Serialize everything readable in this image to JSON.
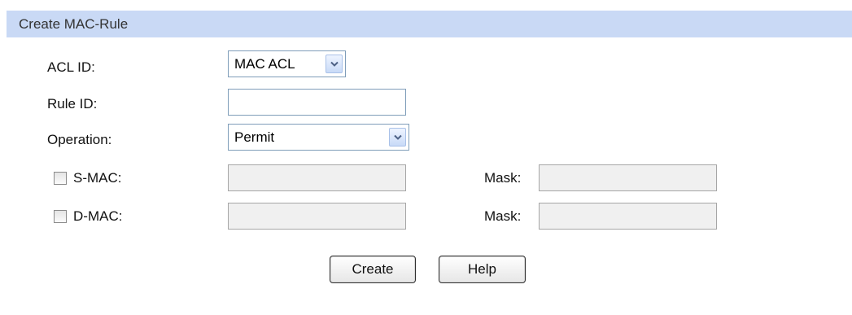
{
  "panel": {
    "title": "Create MAC-Rule"
  },
  "form": {
    "acl_id": {
      "label": "ACL ID:",
      "selected": "MAC ACL"
    },
    "rule_id": {
      "label": "Rule ID:",
      "value": ""
    },
    "operation": {
      "label": "Operation:",
      "selected": "Permit"
    },
    "s_mac": {
      "label": "S-MAC:",
      "checked": false,
      "value": "",
      "mask_label": "Mask:",
      "mask_value": ""
    },
    "d_mac": {
      "label": "D-MAC:",
      "checked": false,
      "value": "",
      "mask_label": "Mask:",
      "mask_value": ""
    }
  },
  "buttons": {
    "create": "Create",
    "help": "Help"
  },
  "icons": {
    "dropdown_arrow": "chevron-down-icon"
  },
  "colors": {
    "header_bg": "#c9d9f5",
    "field_border": "#7f9db9",
    "disabled_bg": "#f0f0f0"
  }
}
